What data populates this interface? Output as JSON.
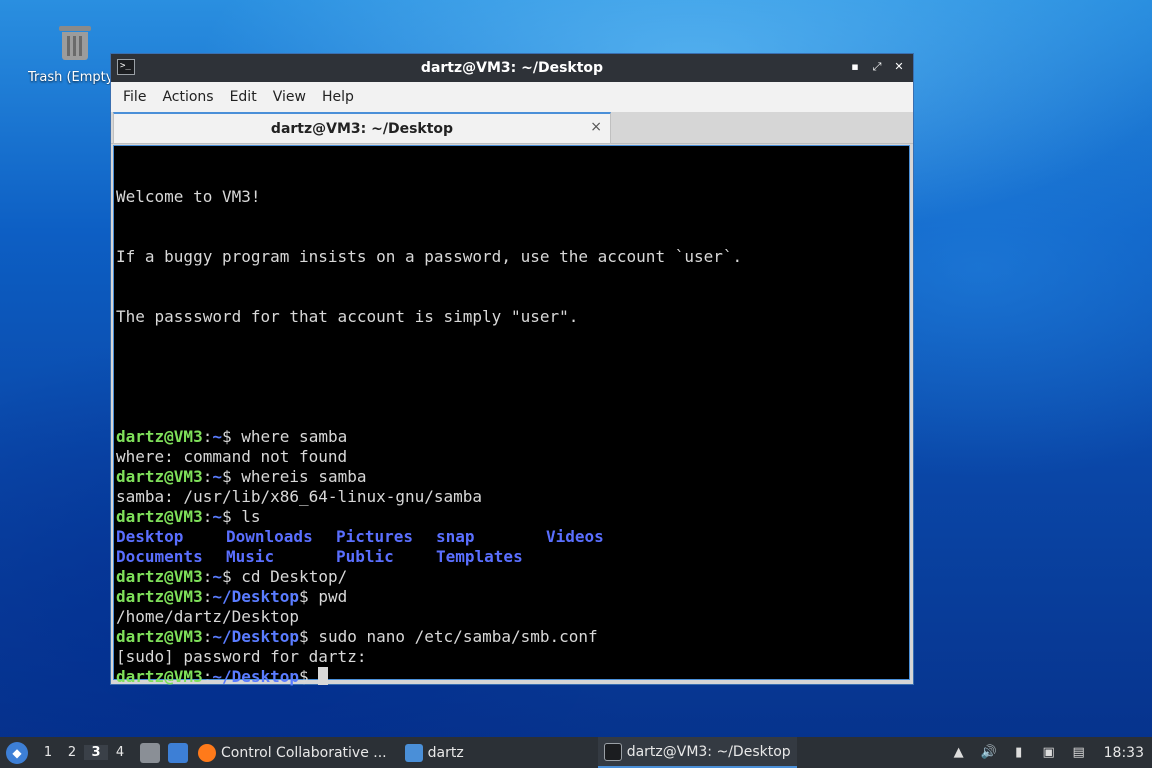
{
  "desktop": {
    "trash_label": "Trash (Empty)"
  },
  "window": {
    "title": "dartz@VM3: ~/Desktop",
    "controls": {
      "minimize": "▪",
      "maximize": "⤢",
      "close": "✕"
    },
    "menu": [
      "File",
      "Actions",
      "Edit",
      "View",
      "Help"
    ],
    "tab_label": "dartz@VM3: ~/Desktop",
    "tab_close": "×"
  },
  "terminal": {
    "welcome": [
      "Welcome to VM3!",
      "If a buggy program insists on a password, use the account `user`.",
      "The passsword for that account is simply \"user\"."
    ],
    "prompt_user": "dartz@VM3",
    "prompt_home": "~",
    "prompt_desktop": "~/Desktop",
    "lines": [
      {
        "type": "cmd",
        "path": "~",
        "cmd": " where samba"
      },
      {
        "type": "out",
        "text": "where: command not found"
      },
      {
        "type": "cmd",
        "path": "~",
        "cmd": " whereis samba"
      },
      {
        "type": "out",
        "text": "samba: /usr/lib/x86_64-linux-gnu/samba"
      },
      {
        "type": "cmd",
        "path": "~",
        "cmd": " ls"
      },
      {
        "type": "dirs",
        "items": [
          "Desktop",
          "Downloads",
          "Pictures",
          "snap",
          "Videos"
        ]
      },
      {
        "type": "dirs",
        "items": [
          "Documents",
          "Music",
          "Public",
          "Templates"
        ]
      },
      {
        "type": "cmd",
        "path": "~",
        "cmd": " cd Desktop/"
      },
      {
        "type": "cmd",
        "path": "~/Desktop",
        "cmd": " pwd"
      },
      {
        "type": "out",
        "text": "/home/dartz/Desktop"
      },
      {
        "type": "cmd",
        "path": "~/Desktop",
        "cmd": " sudo nano /etc/samba/smb.conf"
      },
      {
        "type": "out",
        "text": "[sudo] password for dartz:"
      },
      {
        "type": "cmd",
        "path": "~/Desktop",
        "cmd": " ",
        "cursor": true
      }
    ]
  },
  "taskbar": {
    "workspaces": [
      "1",
      "2",
      "3",
      "4"
    ],
    "active_workspace": "3",
    "tasks": [
      {
        "label": "Control Collaborative ...",
        "icon": "firefox-icon",
        "color": "#ff7a1a"
      },
      {
        "label": "dartz",
        "icon": "folder-icon",
        "color": "#4a8fd8"
      },
      {
        "label": "dartz@VM3: ~/Desktop",
        "icon": "terminal-icon",
        "color": "#1b1d20"
      }
    ],
    "clock": "18:33"
  },
  "colors": {
    "prompt_user": "#7fe05a",
    "prompt_path": "#5a7cff",
    "accent": "#4a8fd8"
  }
}
